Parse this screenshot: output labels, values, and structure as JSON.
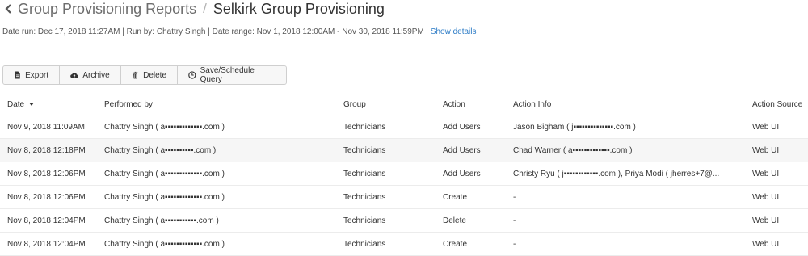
{
  "header": {
    "back_icon": "chevron-left-icon",
    "breadcrumb": "Group Provisioning Reports",
    "separator": "/",
    "title": "Selkirk Group Provisioning"
  },
  "meta": {
    "line": "Date run: Dec 17, 2018 11:27AM | Run by: Chattry Singh | Date range: Nov 1, 2018 12:00AM - Nov 30, 2018 11:59PM",
    "show_details": "Show details"
  },
  "toolbar": {
    "export": {
      "label": "Export",
      "icon": "file-icon"
    },
    "archive": {
      "label": "Archive",
      "icon": "cloud-upload-icon"
    },
    "delete": {
      "label": "Delete",
      "icon": "trash-icon"
    },
    "save": {
      "label": "Save/Schedule Query",
      "icon": "clock-icon"
    }
  },
  "table": {
    "columns": [
      "Date",
      "Performed by",
      "Group",
      "Action",
      "Action Info",
      "Action Source"
    ],
    "sort_icon": "caret-down-icon",
    "rows": [
      {
        "date": "Nov 9, 2018 11:09AM",
        "performed_by": "Chattry Singh ( a▪▪▪▪▪▪▪▪▪▪▪▪▪.com )",
        "group": "Technicians",
        "action": "Add Users",
        "info": "Jason Bigham ( j▪▪▪▪▪▪▪▪▪▪▪▪▪▪.com )",
        "source": "Web UI"
      },
      {
        "date": "Nov 8, 2018 12:18PM",
        "performed_by": "Chattry Singh ( a▪▪▪▪▪▪▪▪▪▪.com )",
        "group": "Technicians",
        "action": "Add Users",
        "info": "Chad Warner ( a▪▪▪▪▪▪▪▪▪▪▪▪▪.com )",
        "source": "Web UI"
      },
      {
        "date": "Nov 8, 2018 12:06PM",
        "performed_by": "Chattry Singh ( a▪▪▪▪▪▪▪▪▪▪▪▪▪.com )",
        "group": "Technicians",
        "action": "Add Users",
        "info": "Christy Ryu ( j▪▪▪▪▪▪▪▪▪▪▪▪.com ), Priya Modi ( jherres+7@...",
        "source": "Web UI"
      },
      {
        "date": "Nov 8, 2018 12:06PM",
        "performed_by": "Chattry Singh ( a▪▪▪▪▪▪▪▪▪▪▪▪▪.com )",
        "group": "Technicians",
        "action": "Create",
        "info": "-",
        "source": "Web UI"
      },
      {
        "date": "Nov 8, 2018 12:04PM",
        "performed_by": "Chattry Singh ( a▪▪▪▪▪▪▪▪▪▪▪.com )",
        "group": "Technicians",
        "action": "Delete",
        "info": "-",
        "source": "Web UI"
      },
      {
        "date": "Nov 8, 2018 12:04PM",
        "performed_by": "Chattry Singh ( a▪▪▪▪▪▪▪▪▪▪▪▪▪.com )",
        "group": "Technicians",
        "action": "Create",
        "info": "-",
        "source": "Web UI"
      }
    ]
  }
}
